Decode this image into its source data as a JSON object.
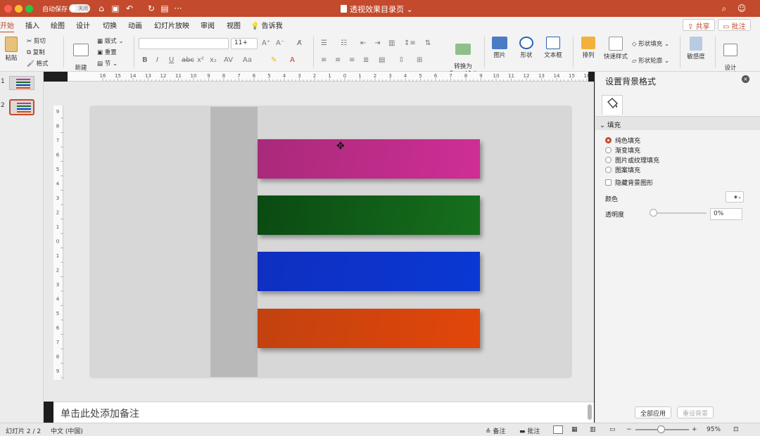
{
  "title_bar": {
    "autosave_label": "自动保存",
    "autosave_state": "关闭",
    "doc_title": "透视效果目录页"
  },
  "tabs": [
    "开始",
    "插入",
    "绘图",
    "设计",
    "切换",
    "动画",
    "幻灯片放映",
    "审阅",
    "视图",
    "告诉我"
  ],
  "header_buttons": {
    "share": "共享",
    "comments": "批注"
  },
  "ribbon": {
    "paste": "粘贴",
    "cut": "剪切",
    "copy": "复制",
    "format": "格式",
    "new_slide": "新建\n幻灯片",
    "layout": "版式",
    "reset": "重置",
    "section": "节",
    "font_size": "11+",
    "convert_smartart": "转换为\nSmartArt",
    "picture": "图片",
    "shape": "形状",
    "textbox": "文本框",
    "arrange": "排列",
    "quick_styles": "快速样式",
    "shape_fill": "形状填充",
    "shape_outline": "形状轮廓",
    "sensitivity": "敏感度",
    "designer": "设计\n灵感"
  },
  "ruler_labels": [
    "16",
    "15",
    "14",
    "13",
    "12",
    "11",
    "10",
    "9",
    "8",
    "7",
    "6",
    "5",
    "4",
    "3",
    "2",
    "1",
    "0",
    "1",
    "2",
    "3",
    "4",
    "5",
    "6",
    "7",
    "8",
    "9",
    "10",
    "11",
    "12",
    "13",
    "14",
    "15",
    "16"
  ],
  "vruler_labels": [
    "9",
    "8",
    "7",
    "6",
    "5",
    "4",
    "3",
    "2",
    "1",
    "0",
    "1",
    "2",
    "3",
    "4",
    "5",
    "6",
    "7",
    "8",
    "9"
  ],
  "slides": [
    {
      "number": "1",
      "selected": false
    },
    {
      "number": "2",
      "selected": true
    }
  ],
  "slide_bars": [
    {
      "color_start": "#a82a7a",
      "color_end": "#cf2e95"
    },
    {
      "color_start": "#0a4a12",
      "color_end": "#17701e"
    },
    {
      "color_start": "#0f2fc0",
      "color_end": "#0a38d4"
    },
    {
      "color_start": "#c2420f",
      "color_end": "#e2460a"
    }
  ],
  "notes_placeholder": "单击此处添加备注",
  "format_pane": {
    "title": "设置背景格式",
    "section": "填充",
    "options": [
      {
        "label": "纯色填充",
        "selected": true
      },
      {
        "label": "渐变填充",
        "selected": false
      },
      {
        "label": "图片或纹理填充",
        "selected": false
      },
      {
        "label": "图案填充",
        "selected": false
      }
    ],
    "hide_bg_graphics": "隐藏背景图形",
    "color_label": "颜色",
    "transparency_label": "透明度",
    "transparency_value": "0%",
    "apply_all": "全部应用",
    "reset_bg": "重设背景"
  },
  "status_bar": {
    "slide_info": "幻灯片 2 / 2",
    "language": "中文 (中国)",
    "notes": "备注",
    "comments": "批注",
    "zoom": "95%"
  },
  "colors": {
    "accent": "#c34a2c"
  }
}
